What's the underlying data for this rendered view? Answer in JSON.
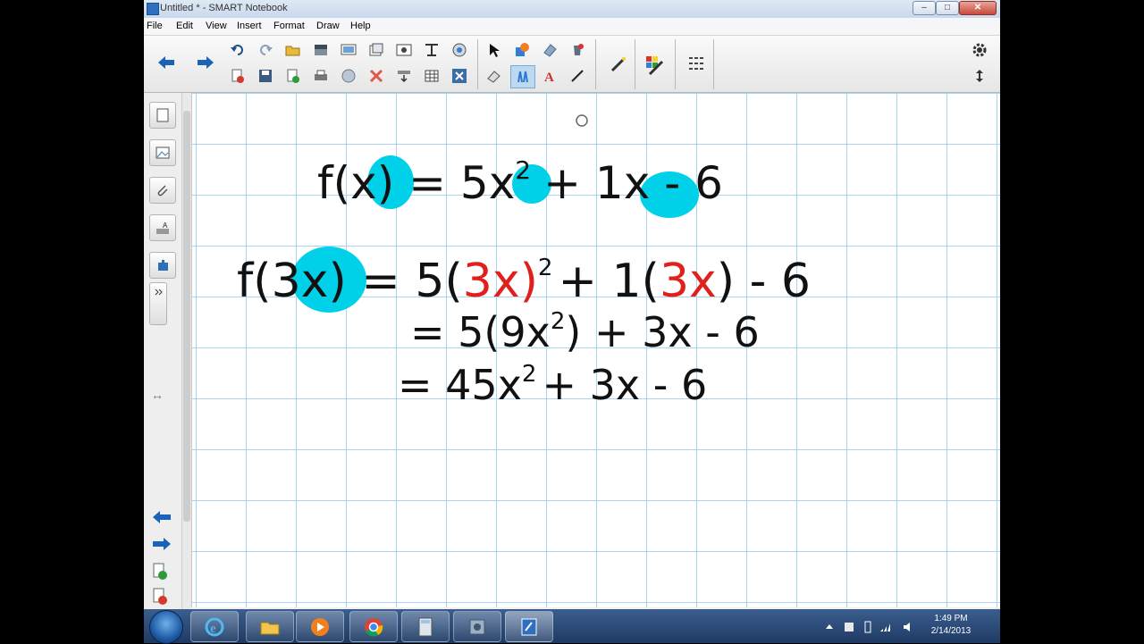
{
  "window": {
    "title": "Untitled * - SMART Notebook"
  },
  "menu": [
    "File",
    "Edit",
    "View",
    "Insert",
    "Format",
    "Draw",
    "Help"
  ],
  "canvas": {
    "line1": [
      "f(x) = 5x",
      "2",
      "+ 1x - 6"
    ],
    "line2": [
      "f(3x) = 5(",
      "3x",
      ")",
      "2",
      "+ 1(",
      "3x",
      ") - 6"
    ],
    "line3": [
      "= 5(9x",
      "2",
      ") + 3x - 6"
    ],
    "line4": [
      "= 45x",
      "2",
      "+ 3x - 6"
    ]
  },
  "clock": {
    "time": "1:49 PM",
    "date": "2/14/2013"
  },
  "colors": {
    "highlight": "#00d0e8",
    "ink_red": "#e0201c",
    "grid": "#a9d5f2"
  },
  "icons": {
    "toolbar": [
      "back-arrow-icon",
      "forward-arrow-icon",
      "undo-icon",
      "redo-icon",
      "open-folder-icon",
      "delete-page-icon",
      "screen-shade-icon",
      "capture-icon",
      "full-screen-icon",
      "document-camera-icon",
      "pointer-icon",
      "pen-icon",
      "eraser-icon",
      "line-icon",
      "text-icon",
      "magic-pen-icon",
      "properties-icon",
      "settings-icon"
    ],
    "sidebar": [
      "page-sorter-icon",
      "gallery-icon",
      "attachments-icon",
      "properties-icon",
      "addons-icon"
    ],
    "taskbar": [
      "ie-icon",
      "explorer-icon",
      "media-player-icon",
      "chrome-icon",
      "calculator-icon",
      "control-panel-icon",
      "notebook-icon"
    ]
  }
}
